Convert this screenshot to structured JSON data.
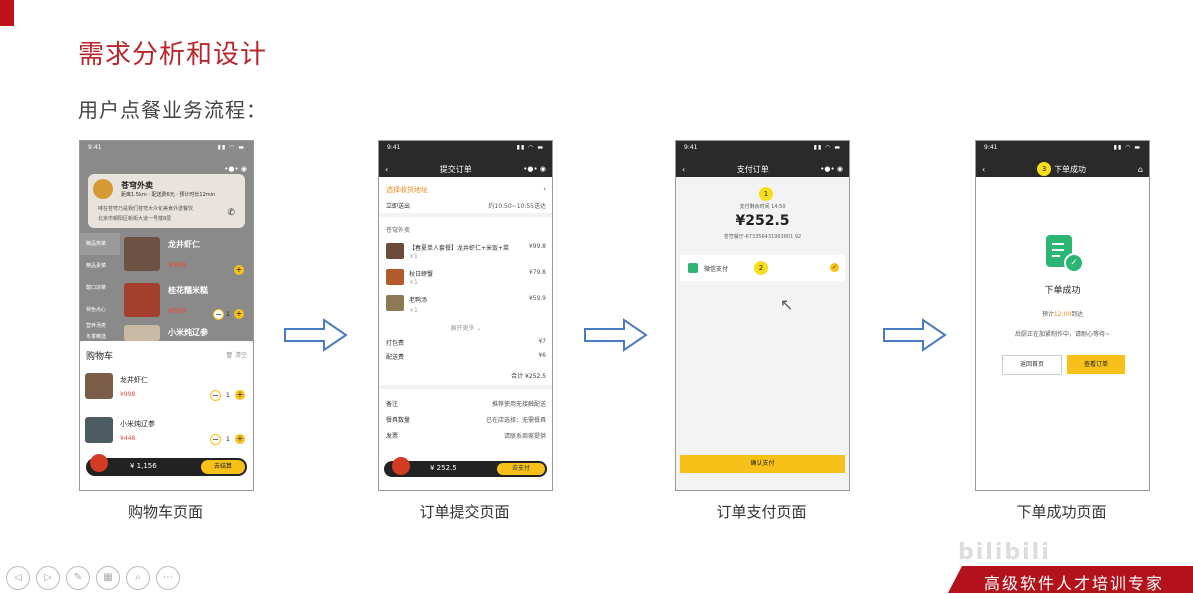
{
  "slide": {
    "title": "需求分析和设计",
    "subtitle": "用户点餐业务流程："
  },
  "captions": [
    "购物车页面",
    "订单提交页面",
    "订单支付页面",
    "下单成功页面"
  ],
  "phone_time": "9:41",
  "phone1": {
    "shop_name": "苍穹外卖",
    "shop_meta": "距离1.5km · 配送费6元 · 预计时长12min",
    "shop_note": "味在苍穹乃是我们苍穹大众化美食外送餐饮",
    "shop_addr": "北京市朝阳区新街大道一号楼8层",
    "categories": [
      "精品热菜",
      "精品素菜",
      "酸口凉菜",
      "特色点心",
      "营养汤类",
      "冬季精选"
    ],
    "menu": [
      {
        "name": "龙井虾仁",
        "price": "¥998"
      },
      {
        "name": "桂花糯米糕",
        "price": "¥668"
      },
      {
        "name": "小米炖辽参",
        "price": ""
      }
    ],
    "cart_title": "购物车",
    "cart_clear": "清空",
    "cart_items": [
      {
        "name": "龙井虾仁",
        "price": "¥998",
        "qty": "1"
      },
      {
        "name": "小米炖辽参",
        "price": "¥448",
        "qty": "1"
      }
    ],
    "cart_total": "¥ 1,156",
    "checkout_label": "去结算"
  },
  "phone2": {
    "nav_title": "提交订单",
    "address_label": "选择收货地址",
    "deliver_label": "立即送出",
    "deliver_time": "约10:50~10:55送达",
    "shop_label": "苍穹外卖",
    "items": [
      {
        "name": "【春夏单人套餐】龙井虾仁+米饭+菜",
        "qty": "×1",
        "price": "¥99.8"
      },
      {
        "name": "秋日螃蟹",
        "qty": "×1",
        "price": "¥79.8"
      },
      {
        "name": "老鸭汤",
        "qty": "×1",
        "price": "¥59.9"
      }
    ],
    "expand_label": "展开更多",
    "pack_label": "打包费",
    "pack_fee": "¥7",
    "delivery_label": "配送费",
    "delivery_fee": "¥6",
    "subtotal": "合计 ¥252.5",
    "remark_label": "备注",
    "remark_value": "推荐使用无接触配送",
    "tableware_label": "餐具数量",
    "tableware_value": "已在店选择：无需餐具",
    "invoice_label": "发票",
    "invoice_value": "请联系商家提供",
    "bar_total": "¥ 252.5",
    "pay_label": "去支付"
  },
  "phone3": {
    "nav_title": "支付订单",
    "step": "1",
    "remain_label": "支付剩余时间 14:50",
    "amount": "¥252.5",
    "order_no": "苍穹餐厅-673356431963801 92",
    "method": "微信支付",
    "step2": "2",
    "confirm_label": "确认支付"
  },
  "phone4": {
    "step": "3",
    "nav_title": "下单成功",
    "success_title": "下单成功",
    "eta_prefix": "预计",
    "eta_time": "12:00",
    "eta_suffix": "到达",
    "message": "后厨正在加紧制作中，请耐心等待~",
    "home_label": "返回首页",
    "view_label": "查看订单"
  },
  "watermark": "bilibili",
  "banner_text": "高级软件人才培训专家",
  "colors": {
    "brand_red": "#b8262b",
    "accent_yellow": "#f7c11a",
    "success_green": "#2bb673"
  }
}
